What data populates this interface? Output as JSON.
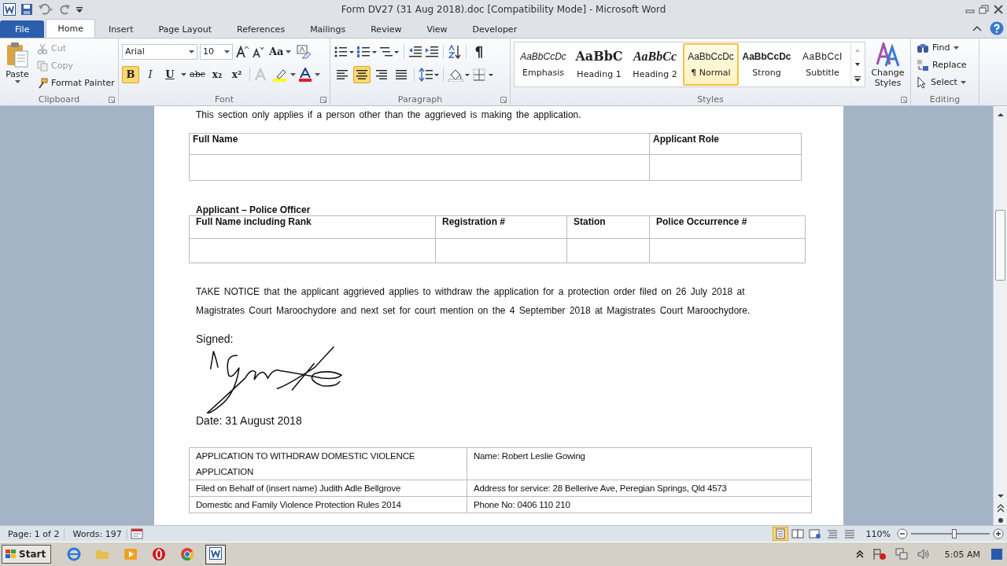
{
  "window": {
    "title": "Form DV27 (31 Aug 2018).doc [Compatibility Mode]  -  Microsoft Word"
  },
  "tabs": [
    {
      "label": "File",
      "kind": "file",
      "selected": false
    },
    {
      "label": "Home",
      "kind": "tab",
      "selected": true
    },
    {
      "label": "Insert",
      "kind": "tab",
      "selected": false
    },
    {
      "label": "Page Layout",
      "kind": "tab",
      "selected": false
    },
    {
      "label": "References",
      "kind": "tab",
      "selected": false
    },
    {
      "label": "Mailings",
      "kind": "tab",
      "selected": false
    },
    {
      "label": "Review",
      "kind": "tab",
      "selected": false
    },
    {
      "label": "View",
      "kind": "tab",
      "selected": false
    },
    {
      "label": "Developer",
      "kind": "tab",
      "selected": false
    }
  ],
  "clipboard": {
    "label": "Clipboard",
    "paste": "Paste",
    "cut": "Cut",
    "copy": "Copy",
    "format_painter": "Format Painter"
  },
  "font": {
    "label": "Font",
    "name": "Arial",
    "size": "10",
    "case": "Aa",
    "buttons": [
      {
        "label": "B",
        "kind": "bold",
        "on": true
      },
      {
        "label": "I",
        "kind": "italic",
        "on": false
      },
      {
        "label": "U",
        "kind": "underline",
        "on": false
      },
      {
        "label": "abc",
        "kind": "strike",
        "on": false
      },
      {
        "label": "x₂",
        "kind": "sub",
        "on": false
      },
      {
        "label": "x²",
        "kind": "sup",
        "on": false
      }
    ]
  },
  "paragraph": {
    "label": "Paragraph",
    "pilcrow": "¶",
    "alignments": [
      {
        "kind": "left",
        "selected": false
      },
      {
        "kind": "center",
        "selected": true
      },
      {
        "kind": "right",
        "selected": false
      },
      {
        "kind": "justify",
        "selected": false
      }
    ]
  },
  "styles": {
    "label": "Styles",
    "change_styles": "Change Styles",
    "items": [
      {
        "preview": "AaBbCcDc",
        "name": "Emphasis",
        "kind": "emphasis",
        "selected": false
      },
      {
        "preview": "AaBbC",
        "name": "Heading 1",
        "kind": "heading1",
        "selected": false
      },
      {
        "preview": "AaBbCc",
        "name": "Heading 2",
        "kind": "heading2",
        "selected": false
      },
      {
        "preview": "AaBbCcDc",
        "name": "¶ Normal",
        "kind": "normal",
        "selected": true
      },
      {
        "preview": "AaBbCcDc",
        "name": "Strong",
        "kind": "strong",
        "selected": false
      },
      {
        "preview": "AaBbCcI",
        "name": "Subtitle",
        "kind": "subtitle",
        "selected": false
      }
    ]
  },
  "editing": {
    "label": "Editing",
    "find": "Find",
    "replace": "Replace",
    "select": "Select"
  },
  "document": {
    "intro": "This section only applies if a person other than the aggrieved is making the application.",
    "applicant_table": {
      "columns": [
        "Full Name",
        "Applicant Role"
      ]
    },
    "police_heading": "Applicant – Police Officer",
    "police_table": {
      "columns": [
        "Full Name including Rank",
        "Registration #",
        "Station",
        "Police Occurrence #"
      ]
    },
    "notice": "TAKE NOTICE that the applicant aggrieved applies to withdraw the application for a protection order filed on 26 July 2018 at Magistrates Court Maroochydore and next set for court mention on the 4 September 2018 at Magistrates Court Maroochydore.",
    "signed": "Signed:",
    "date": "Date:  31 August 2018",
    "footer_table": {
      "rows": [
        [
          "APPLICATION TO WITHDRAW DOMESTIC VIOLENCE APPLICATION",
          "Name: Robert Leslie Gowing"
        ],
        [
          "Filed on Behalf of (insert name) Judith Adle Bellgrove",
          "Address for service:  28 Bellerive Ave,  Peregian Springs, Qld 4573"
        ],
        [
          "Domestic and Family Violence Protection Rules 2014",
          "Phone No: 0406 110 210"
        ]
      ]
    }
  },
  "status_bar": {
    "page": "Page: 1 of 2",
    "words": "Words: 197",
    "zoom": "110%",
    "zoom_level": {
      "level": 0.55
    }
  },
  "taskbar": {
    "start": "Start",
    "clock": "5:05 AM"
  }
}
